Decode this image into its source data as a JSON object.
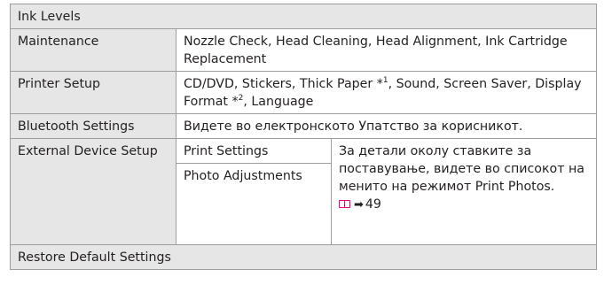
{
  "rows": {
    "ink_levels": "Ink Levels",
    "maintenance": {
      "label": "Maintenance",
      "value": "Nozzle Check, Head Cleaning, Head Alignment, Ink Cartridge Replacement"
    },
    "printer_setup": {
      "label": "Printer Setup",
      "value_part1": "CD/DVD, Stickers, Thick Paper *",
      "sup1": "1",
      "value_part2": ", Sound, Screen Saver, Display Format *",
      "sup2": "2",
      "value_part3": ", Language"
    },
    "bluetooth": {
      "label": "Bluetooth Settings",
      "value": "Видете во електронското Упатство за корисникот."
    },
    "external_device": {
      "label": "External Device Setup",
      "sub_items": [
        "Print Settings",
        "Photo Adjustments"
      ],
      "note": "За детали околу ставките за поставување, видете во списокот на менито на режимот Print Photos.",
      "page_ref": "49",
      "book_icon": "book-icon",
      "arrow_icon": "right-arrow-icon",
      "icon_color": "#e6007e"
    },
    "restore": "Restore Default Settings"
  }
}
